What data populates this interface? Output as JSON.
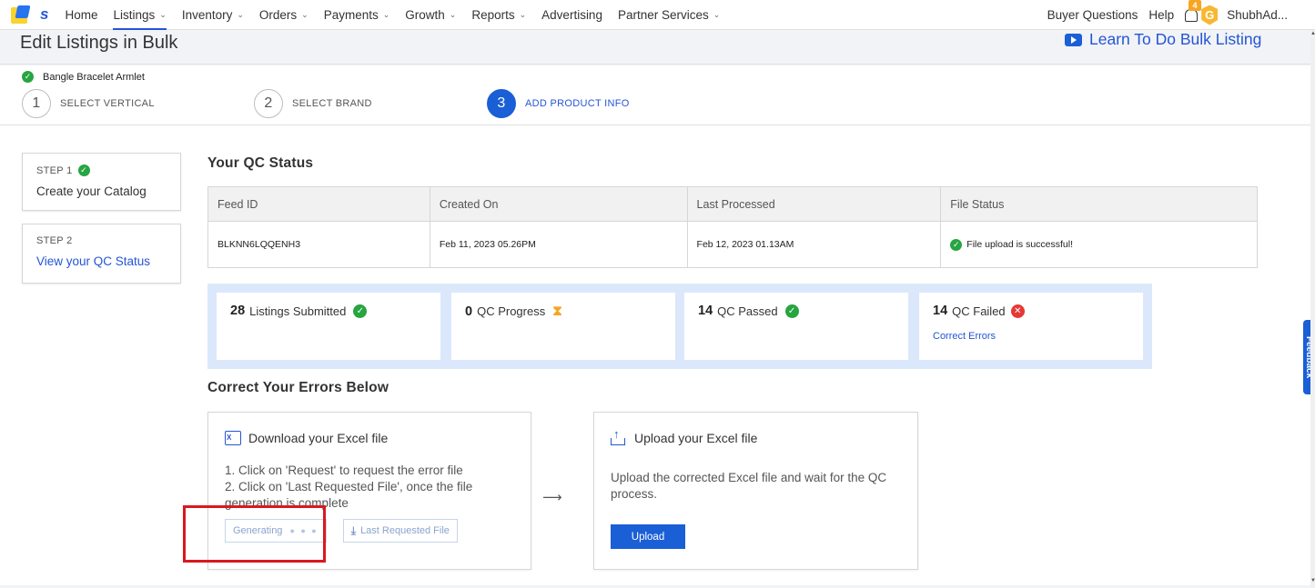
{
  "nav": {
    "brand": "s",
    "items": [
      {
        "label": "Home",
        "dropdown": false,
        "active": false
      },
      {
        "label": "Listings",
        "dropdown": true,
        "active": true
      },
      {
        "label": "Inventory",
        "dropdown": true,
        "active": false
      },
      {
        "label": "Orders",
        "dropdown": true,
        "active": false
      },
      {
        "label": "Payments",
        "dropdown": true,
        "active": false
      },
      {
        "label": "Growth",
        "dropdown": true,
        "active": false
      },
      {
        "label": "Reports",
        "dropdown": true,
        "active": false
      },
      {
        "label": "Advertising",
        "dropdown": false,
        "active": false
      },
      {
        "label": "Partner Services",
        "dropdown": true,
        "active": false
      }
    ],
    "buyer_questions": "Buyer Questions",
    "help": "Help",
    "notification_count": "4",
    "avatar_letter": "G",
    "user_name": "ShubhAd..."
  },
  "header": {
    "title": "Edit Listings in Bulk",
    "learn_link": "Learn To Do Bulk Listing"
  },
  "stepper": {
    "selected_vertical": "Bangle Bracelet Armlet",
    "steps": [
      {
        "number": "1",
        "label": "SELECT VERTICAL"
      },
      {
        "number": "2",
        "label": "SELECT BRAND"
      },
      {
        "number": "3",
        "label": "ADD PRODUCT INFO"
      }
    ]
  },
  "sidebar": {
    "step1_label": "STEP 1",
    "step1_text": "Create your Catalog",
    "step2_label": "STEP 2",
    "step2_text": "View your QC Status"
  },
  "qc": {
    "title": "Your QC Status",
    "columns": [
      "Feed ID",
      "Created On",
      "Last Processed",
      "File Status"
    ],
    "row": {
      "feed_id": "BLKNN6LQQENH3",
      "created_on": "Feb 11, 2023 05.26PM",
      "last_processed": "Feb 12, 2023 01.13AM",
      "file_status": "File upload is successful!"
    }
  },
  "stats": {
    "submitted_count": "28",
    "submitted_label": "Listings Submitted",
    "progress_count": "0",
    "progress_label": "QC Progress",
    "passed_count": "14",
    "passed_label": "QC Passed",
    "failed_count": "14",
    "failed_label": "QC Failed",
    "correct_errors": "Correct Errors"
  },
  "errors": {
    "title": "Correct Your Errors Below",
    "download": {
      "title": "Download your Excel file",
      "line1": "1. Click on 'Request' to request the error file",
      "line2": "2. Click on 'Last Requested File', once the file generation is complete",
      "generating_button": "Generating",
      "last_file_button": "Last Requested File"
    },
    "upload": {
      "title": "Upload your Excel file",
      "body": "Upload the corrected Excel file and wait for the QC process.",
      "button": "Upload"
    }
  },
  "feedback_tab": "Feedback",
  "colors": {
    "primary": "#1a5fd6",
    "success": "#26a541",
    "error": "#e53935",
    "warning": "#f6a623",
    "highlight": "#d9191f"
  }
}
